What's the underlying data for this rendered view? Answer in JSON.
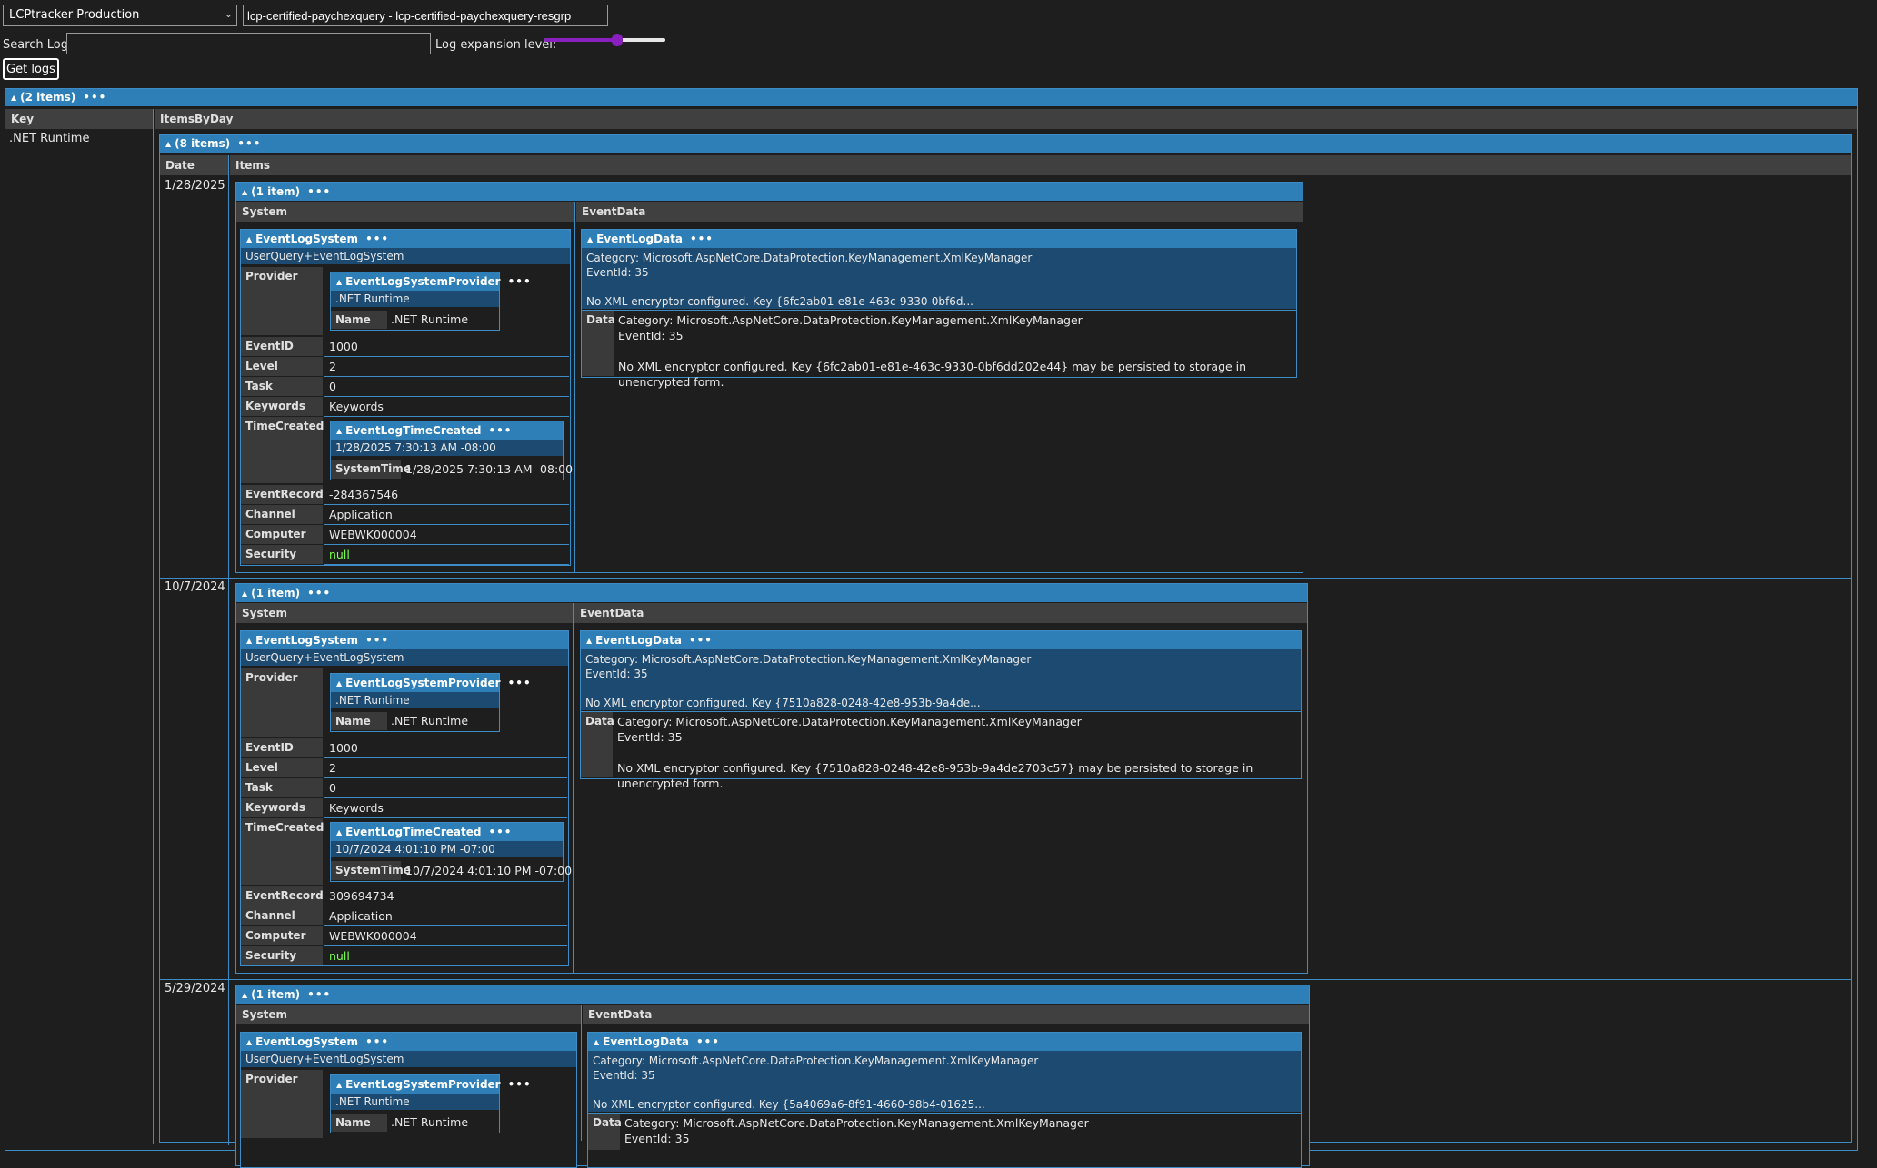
{
  "controls": {
    "environment_select": "LCPtracker Production",
    "target_field": "lcp-certified-paychexquery - lcp-certified-paychexquery-resgrp",
    "search_label": "Search Log:",
    "search_value": "",
    "expansion_label": "Log expansion level:",
    "expansion_fraction": 0.6,
    "get_logs_label": "Get logs"
  },
  "root": {
    "count_label": "(2 items)",
    "more": "•••",
    "col_key": "Key",
    "col_items": "ItemsByDay",
    "key_value": ".NET Runtime"
  },
  "days": {
    "count_label": "(8 items)",
    "more": "•••",
    "col_date": "Date",
    "col_items": "Items"
  },
  "labels": {
    "item_count": "(1 item)",
    "more": "•••",
    "col_system": "System",
    "col_eventdata": "EventData",
    "event_log_system": "EventLogSystem",
    "userquery": "UserQuery+EventLogSystem",
    "provider": "Provider",
    "provider_box": "EventLogSystemProvider",
    "provider_sub": ".NET Runtime",
    "name": "Name",
    "name_value": ".NET Runtime",
    "eventid": "EventID",
    "level": "Level",
    "task": "Task",
    "keywords": "Keywords",
    "timecreated": "TimeCreated",
    "time_box": "EventLogTimeCreated",
    "systemtime": "SystemTime",
    "eventrecordid": "EventRecordID",
    "channel": "Channel",
    "computer": "Computer",
    "security": "Security",
    "event_log_data": "EventLogData",
    "data": "Data"
  },
  "entries": [
    {
      "date": "1/28/2025",
      "eventid": "1000",
      "level": "2",
      "task": "0",
      "keywords": "Keywords",
      "time": "1/28/2025 7:30:13 AM -08:00",
      "systemtime": "1/28/2025 7:30:13 AM -08:00",
      "recordid": "-284367546",
      "channel": "Application",
      "computer": "WEBWK000004",
      "security": "null",
      "summary": "Category: Microsoft.AspNetCore.DataProtection.KeyManagement.XmlKeyManager\nEventId: 35\n\nNo XML encryptor configured. Key {6fc2ab01-e81e-463c-9330-0bf6d...",
      "data": "Category: Microsoft.AspNetCore.DataProtection.KeyManagement.XmlKeyManager\nEventId: 35\n\nNo XML encryptor configured. Key {6fc2ab01-e81e-463c-9330-0bf6dd202e44} may be persisted to storage in unencrypted form."
    },
    {
      "date": "10/7/2024",
      "eventid": "1000",
      "level": "2",
      "task": "0",
      "keywords": "Keywords",
      "time": "10/7/2024 4:01:10 PM -07:00",
      "systemtime": "10/7/2024 4:01:10 PM -07:00",
      "recordid": "309694734",
      "channel": "Application",
      "computer": "WEBWK000004",
      "security": "null",
      "summary": "Category: Microsoft.AspNetCore.DataProtection.KeyManagement.XmlKeyManager\nEventId: 35\n\nNo XML encryptor configured. Key {7510a828-0248-42e8-953b-9a4de...",
      "data": "Category: Microsoft.AspNetCore.DataProtection.KeyManagement.XmlKeyManager\nEventId: 35\n\nNo XML encryptor configured. Key {7510a828-0248-42e8-953b-9a4de2703c57} may be persisted to storage in unencrypted form."
    },
    {
      "date": "5/29/2024",
      "summary": "Category: Microsoft.AspNetCore.DataProtection.KeyManagement.XmlKeyManager\nEventId: 35\n\nNo XML encryptor configured. Key {5a4069a6-8f91-4660-98b4-01625...",
      "data": "Category: Microsoft.AspNetCore.DataProtection.KeyManagement.XmlKeyManager\nEventId: 35"
    }
  ]
}
